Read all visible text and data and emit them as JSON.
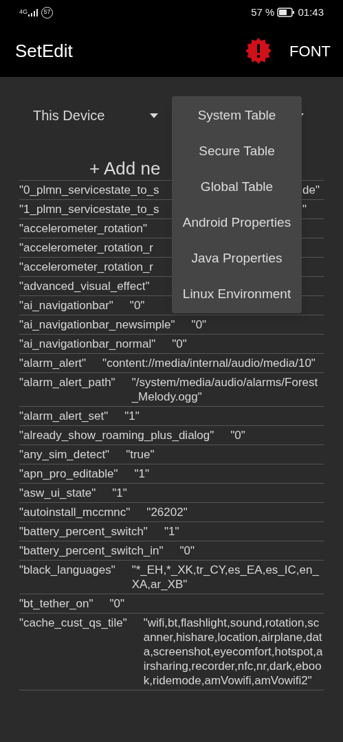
{
  "status_bar": {
    "network": "4G",
    "notification_count": "57",
    "battery_percent": "57 %",
    "time": "01:43"
  },
  "toolbar": {
    "title": "SetEdit",
    "action": "FONT"
  },
  "spinners": [
    {
      "kind": "dropdown",
      "label": "This Device"
    },
    {
      "kind": "dropdown"
    }
  ],
  "add_new": "+ Add ne",
  "rows": [
    {
      "kind": "partial",
      "key": "\"0_plmn_servicestate_to_s",
      "value": "de\""
    },
    {
      "kind": "partial",
      "key": "\"1_plmn_servicestate_to_s",
      "value": "\""
    },
    {
      "kind": "full",
      "key": "\"accelerometer_rotation\""
    },
    {
      "kind": "full",
      "key": "\"accelerometer_rotation_r"
    },
    {
      "kind": "full",
      "key": "\"accelerometer_rotation_r"
    },
    {
      "kind": "full",
      "key": "\"advanced_visual_effect\""
    },
    {
      "kind": "full",
      "key": "\"ai_navigationbar\"",
      "value": "\"0\""
    },
    {
      "kind": "full",
      "key": "\"ai_navigationbar_newsimple\"",
      "value": "\"0\""
    },
    {
      "kind": "full",
      "key": "\"ai_navigationbar_normal\"",
      "value": "\"0\""
    },
    {
      "kind": "full",
      "key": "\"alarm_alert\"",
      "value": "\"content://media/internal/audio/media/10\""
    },
    {
      "kind": "full",
      "key": "\"alarm_alert_path\"",
      "value": "\"/system/media/audio/alarms/Forest_Melody.ogg\""
    },
    {
      "kind": "full",
      "key": "\"alarm_alert_set\"",
      "value": "\"1\""
    },
    {
      "kind": "full",
      "key": "\"already_show_roaming_plus_dialog\"",
      "value": "\"0\""
    },
    {
      "kind": "full",
      "key": "\"any_sim_detect\"",
      "value": "\"true\""
    },
    {
      "kind": "full",
      "key": "\"apn_pro_editable\"",
      "value": "\"1\""
    },
    {
      "kind": "full",
      "key": "\"asw_ui_state\"",
      "value": "\"1\""
    },
    {
      "kind": "full",
      "key": "\"autoinstall_mccmnc\"",
      "value": "\"26202\""
    },
    {
      "kind": "full",
      "key": "\"battery_percent_switch\"",
      "value": "\"1\""
    },
    {
      "kind": "full",
      "key": "\"battery_percent_switch_in\"",
      "value": "\"0\""
    },
    {
      "kind": "full",
      "key": "\"black_languages\"",
      "value": "\"*_EH,*_XK,tr_CY,es_EA,es_IC,en_XA,ar_XB\""
    },
    {
      "kind": "full",
      "key": "\"bt_tether_on\"",
      "value": "\"0\""
    },
    {
      "kind": "full",
      "key": "\"cache_cust_qs_tile\"",
      "value": "\"wifi,bt,flashlight,sound,rotation,scanner,hishare,location,airplane,data,screenshot,eyecomfort,hotspot,airsharing,recorder,nfc,nr,dark,ebook,ridemode,amVowifi,amVowifi2\""
    }
  ],
  "menu": {
    "items": [
      {
        "label": "System Table"
      },
      {
        "label": "Secure Table"
      },
      {
        "label": "Global Table"
      },
      {
        "label": "Android Properties"
      },
      {
        "label": "Java Properties"
      },
      {
        "label": "Linux Environment"
      }
    ]
  }
}
